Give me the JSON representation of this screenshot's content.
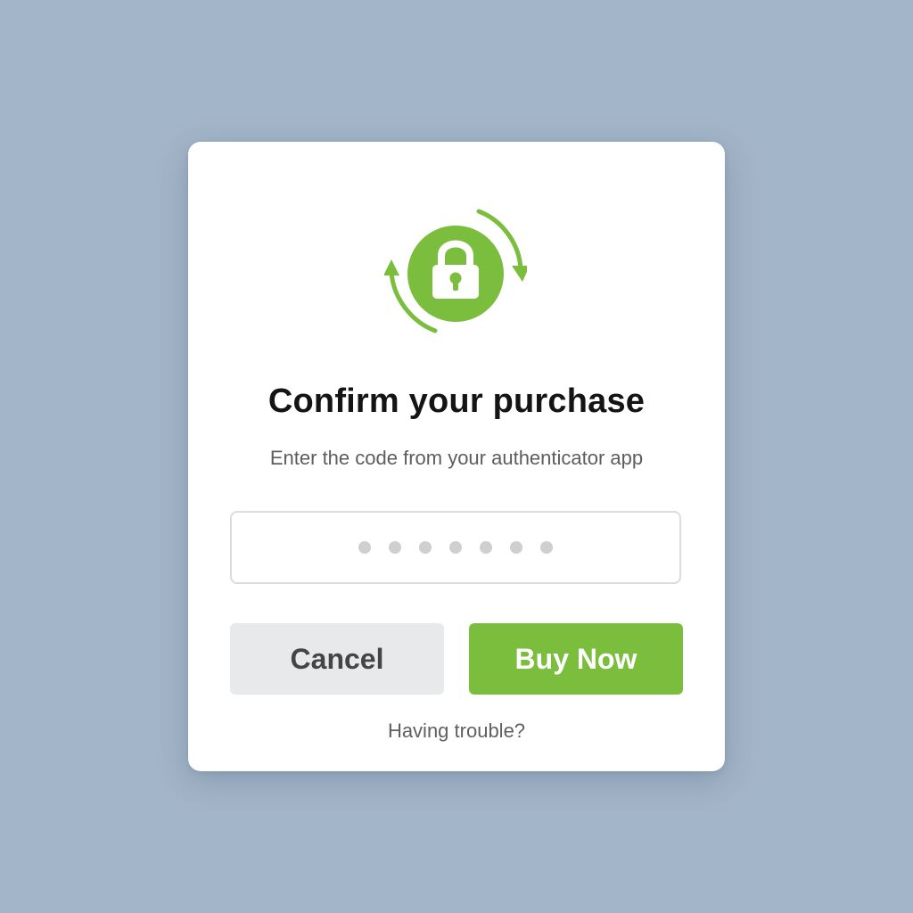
{
  "dialog": {
    "icon": "refresh-lock-icon",
    "title": "Confirm your purchase",
    "subtitle": "Enter the code from your authenticator app",
    "code_input": {
      "value": "",
      "masked_dots": 7
    },
    "buttons": {
      "cancel_label": "Cancel",
      "buy_label": "Buy Now"
    },
    "help_link": "Having trouble?"
  },
  "colors": {
    "background": "#a3b5c8",
    "accent": "#7bbd3d",
    "cancel_bg": "#e8e9ea",
    "title_text": "#141414",
    "muted_text": "#5d5d5d"
  }
}
